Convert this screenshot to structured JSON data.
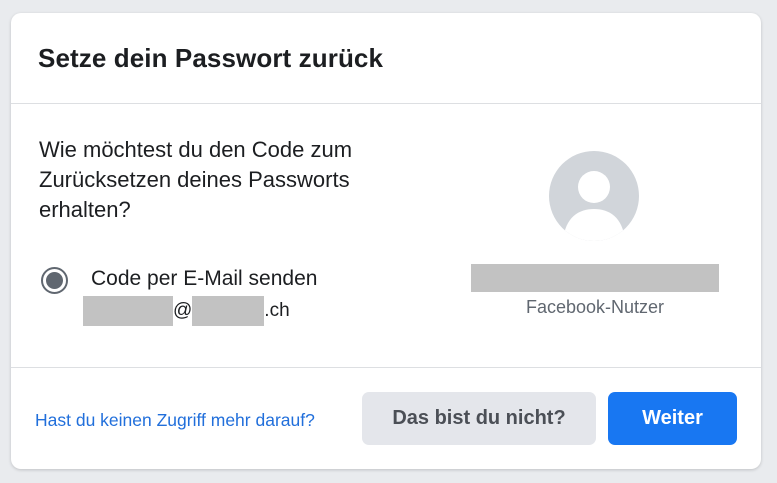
{
  "dialog": {
    "title": "Setze dein Passwort zurück",
    "question": "Wie möchtest du den Code zum Zurücksetzen deines Passworts erhalten?",
    "option_label": "Code per E-Mail senden",
    "email_at": "@",
    "email_suffix": ".ch",
    "user_label": "Facebook-Nutzer",
    "no_access_link": "Hast du keinen Zugriff mehr darauf?",
    "not_you_button": "Das bist du nicht?",
    "continue_button": "Weiter"
  },
  "colors": {
    "primary": "#1877f2",
    "link": "#216fdb",
    "redaction": "#c2c2c2"
  }
}
